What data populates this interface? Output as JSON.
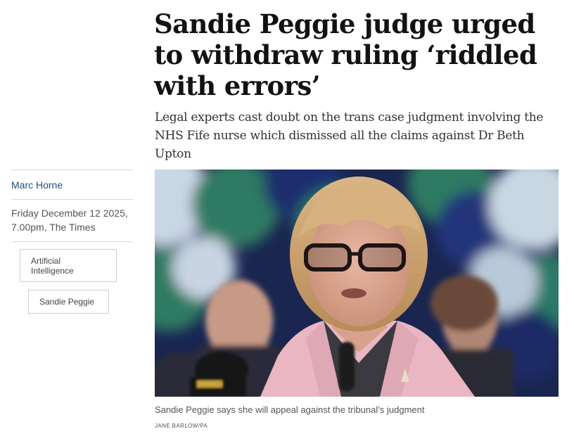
{
  "article": {
    "headline": "Sandie Peggie judge urged to withdraw ruling ‘riddled with errors’",
    "standfirst": "Legal experts cast doubt on the trans case judgment involving the NHS Fife nurse which dismissed all the claims against Dr Beth Upton"
  },
  "meta": {
    "author": "Marc Horne",
    "date_line_1": "Friday December 12 2025,",
    "date_line_2": "7.00pm, The Times",
    "tags": [
      "Artificial Intelligence",
      "Sandie Peggie"
    ]
  },
  "photo": {
    "caption": "Sandie Peggie says she will appeal against the tribunal’s judgment",
    "credit": "JANE BARLOW/PA"
  },
  "colors": {
    "author_link": "#1f4e79",
    "jacket_pink": "#e9b6c1",
    "balloon_green": "#2f7a62",
    "balloon_navy": "#1f2f6e"
  }
}
